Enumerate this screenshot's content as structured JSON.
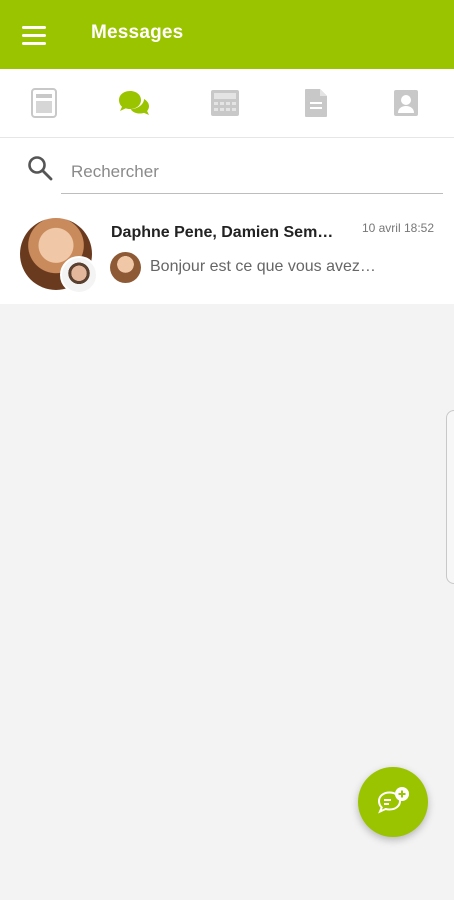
{
  "appbar": {
    "title": "Messages",
    "menu_icon": "menu-icon"
  },
  "colors": {
    "brand": "#9bc400",
    "active_tab": "#9bc400",
    "inactive_tab": "#c8c8c8",
    "background": "#f3f3f3"
  },
  "tabs": [
    {
      "icon": "document-icon",
      "active": false
    },
    {
      "icon": "chat-icon",
      "active": true
    },
    {
      "icon": "calendar-icon",
      "active": false
    },
    {
      "icon": "file-icon",
      "active": false
    },
    {
      "icon": "contact-icon",
      "active": false
    }
  ],
  "search": {
    "placeholder": "Rechercher",
    "value": ""
  },
  "conversations": [
    {
      "participants": "Daphne Pene, Damien Sem…",
      "time": "10 avril 18:52",
      "preview": "Bonjour est ce que vous avez…"
    }
  ],
  "fab": {
    "icon": "new-chat-icon"
  }
}
